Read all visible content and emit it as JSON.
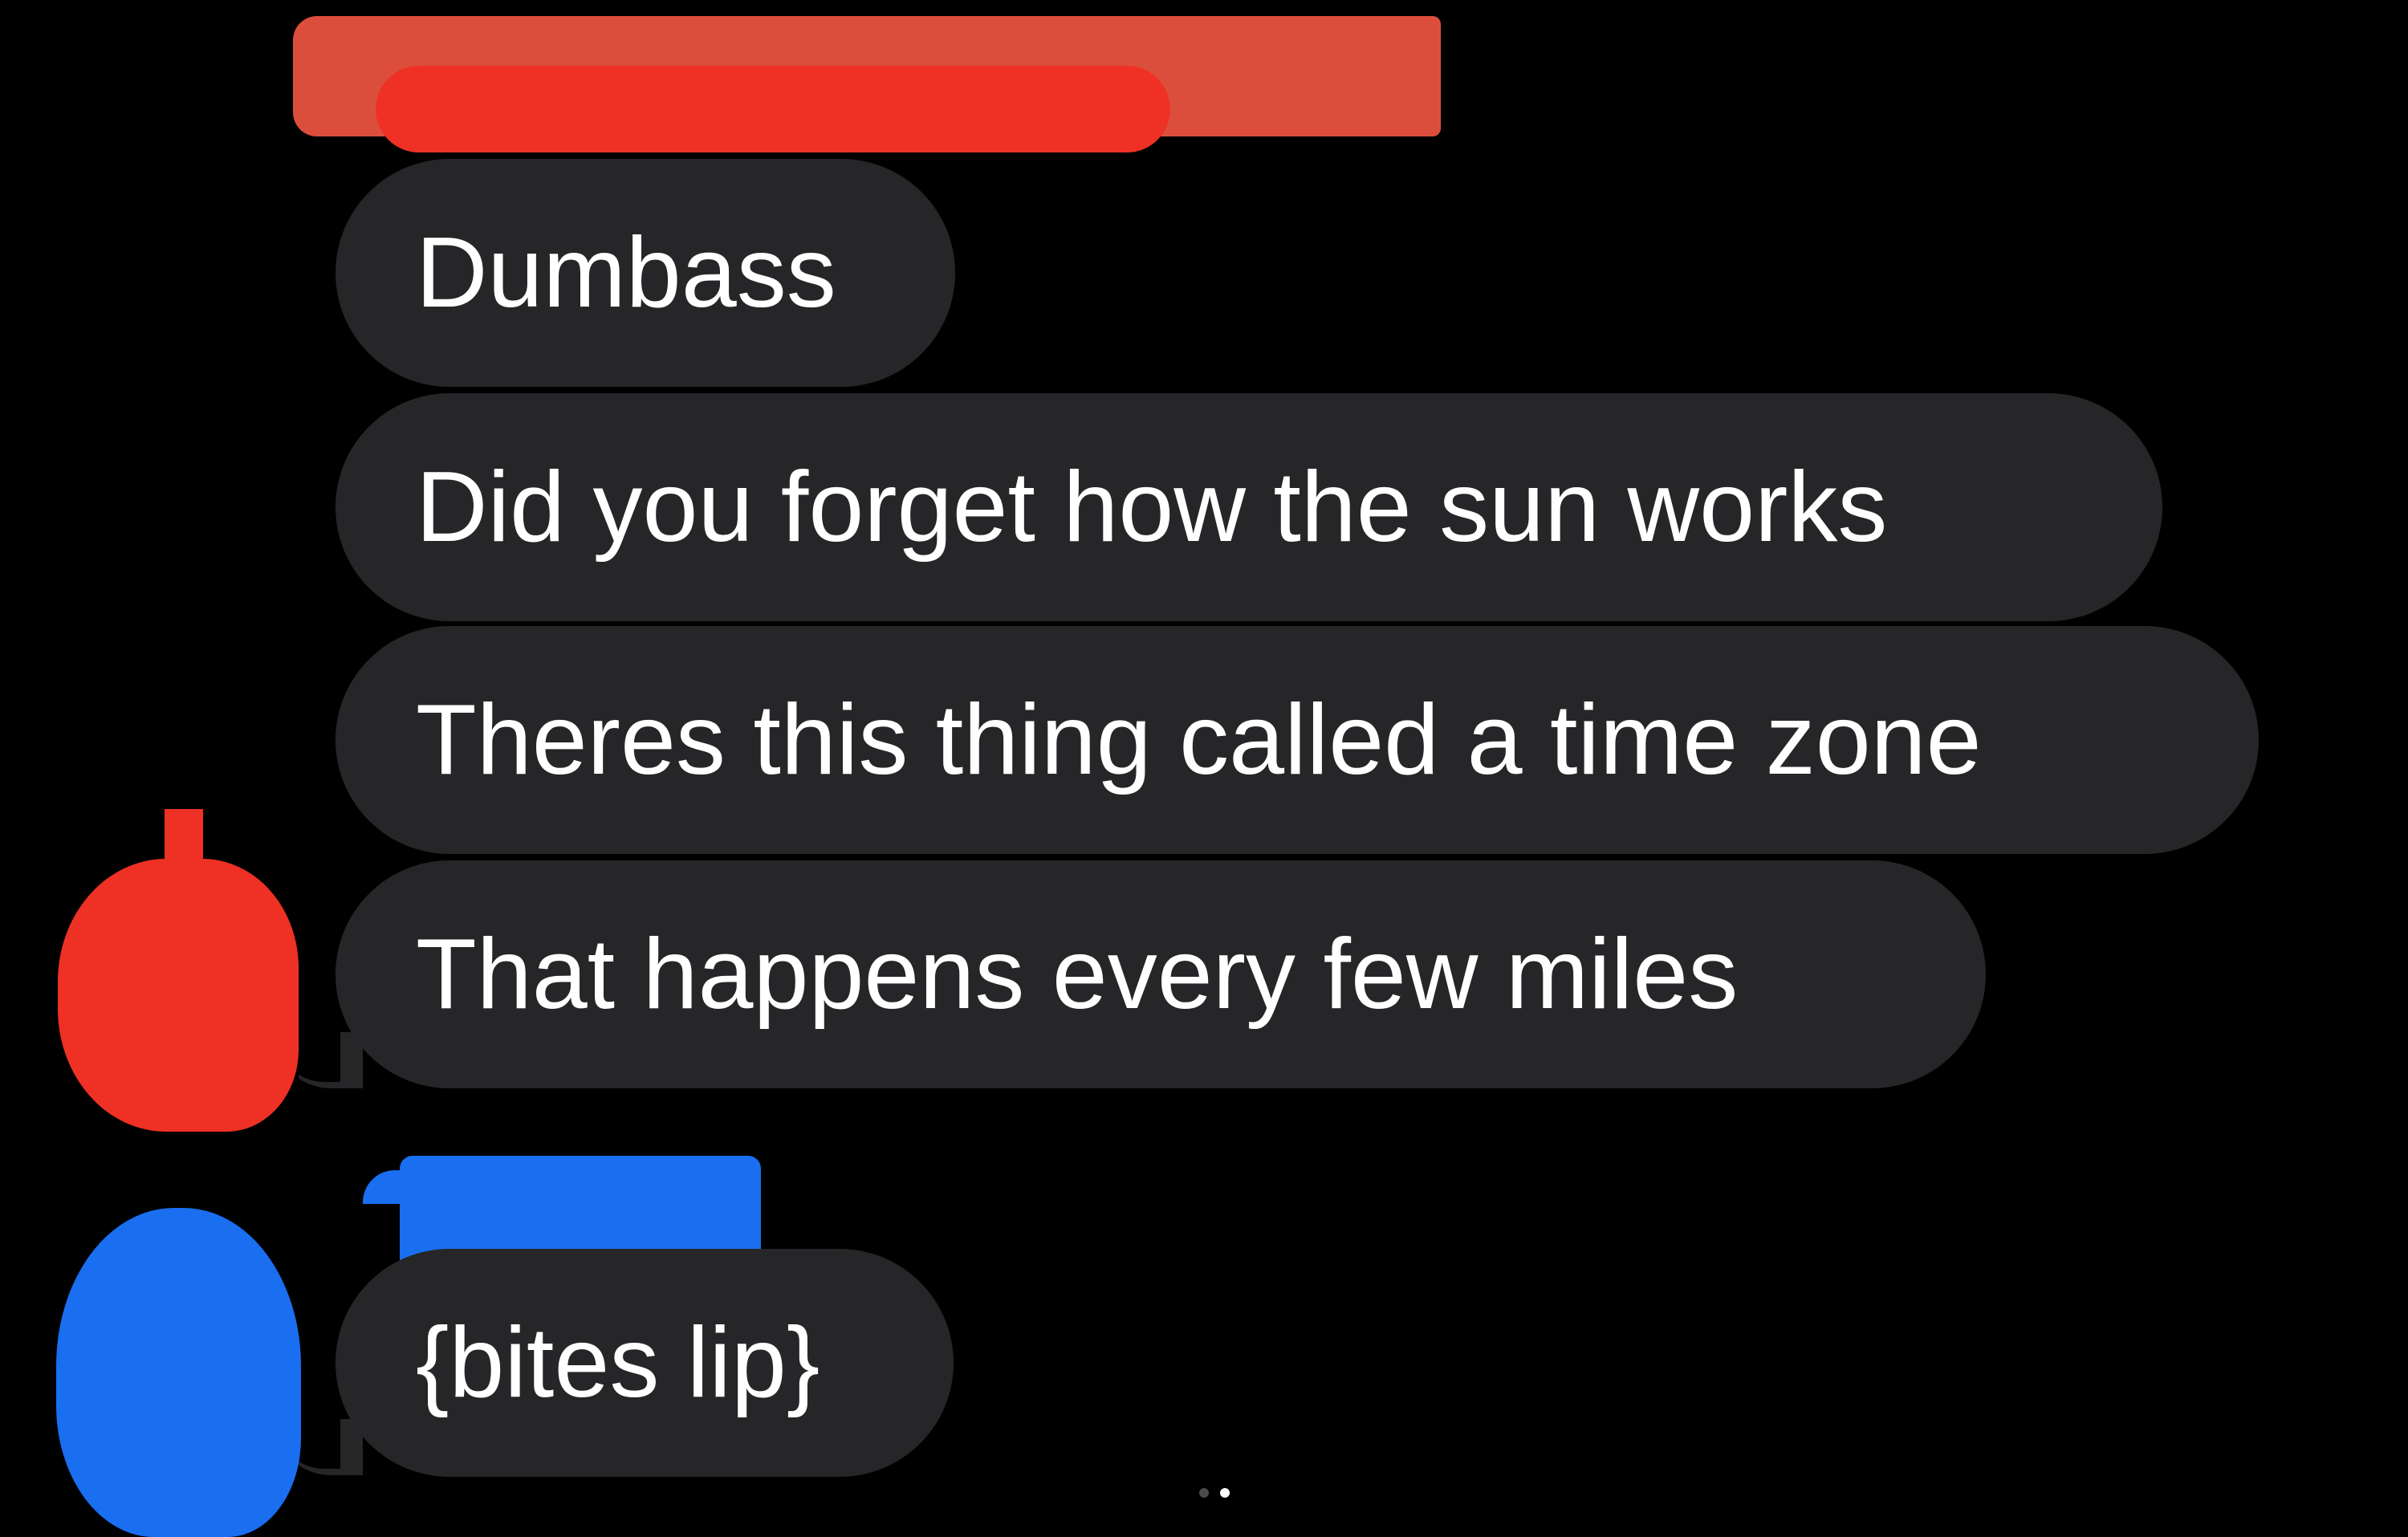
{
  "conversation": {
    "messages": [
      {
        "text": "Dumbass"
      },
      {
        "text": "Did you forget how the sun works"
      },
      {
        "text": "Theres this thing called a time zone"
      },
      {
        "text": "That happens every few miles"
      },
      {
        "text": "{bites lip}"
      }
    ]
  },
  "page_indicator": {
    "count": 2,
    "active": 2
  },
  "colors": {
    "background": "#000000",
    "bubble": "#262628",
    "text": "#ffffff",
    "redaction_red": "#ee3124",
    "redaction_blue": "#1a6ef0"
  },
  "icons": {
    "sender_one_avatar": "avatar-redacted-red",
    "sender_two_avatar": "avatar-redacted-blue"
  }
}
